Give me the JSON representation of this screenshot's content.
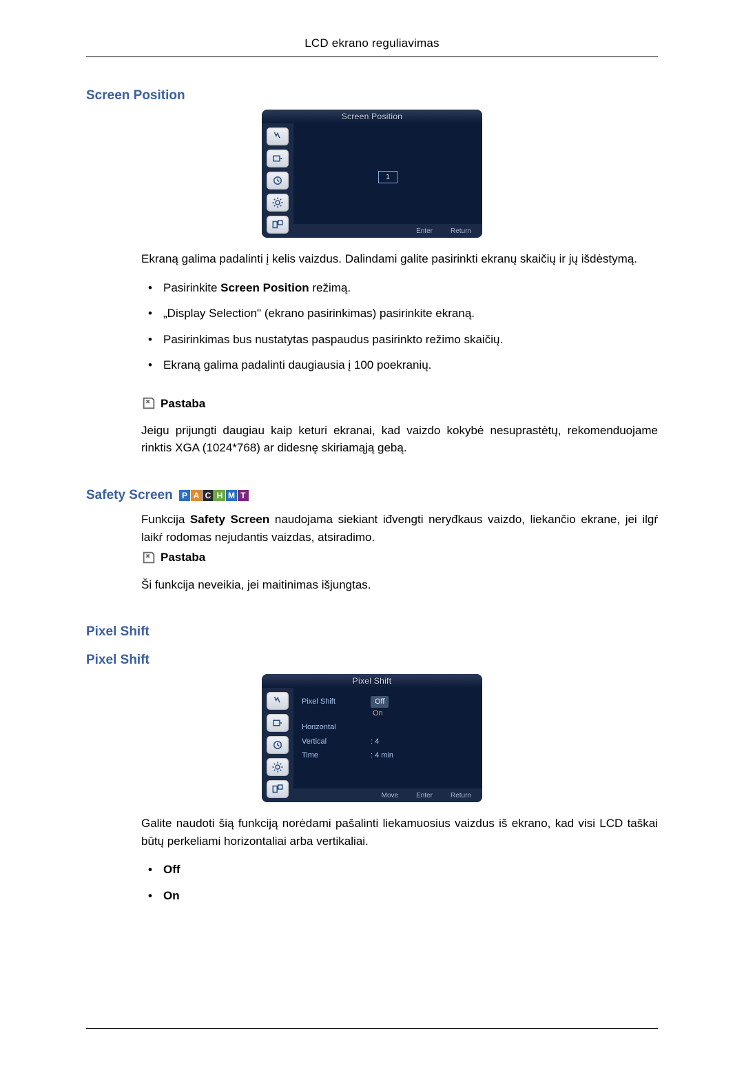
{
  "header": {
    "title": "LCD ekrano reguliavimas"
  },
  "section1": {
    "heading": "Screen Position",
    "osd": {
      "title": "Screen Position",
      "number": "1",
      "footer_enter": "Enter",
      "footer_return": "Return"
    },
    "intro": "Ekraną galima padalinti į kelis vaizdus. Dalindami galite pasirinkti ekranų skaičių ir jų išdėstymą.",
    "bullets": [
      {
        "pre": "Pasirinkite ",
        "bold": "Screen Position",
        "post": " režimą."
      },
      {
        "pre": "„Display Selection\" (ekrano pasirinkimas) pasirinkite ekraną.",
        "bold": "",
        "post": ""
      },
      {
        "pre": "Pasirinkimas bus nustatytas paspaudus pasirinkto režimo skaičių.",
        "bold": "",
        "post": ""
      },
      {
        "pre": "Ekraną galima padalinti daugiausia į 100 poekranių.",
        "bold": "",
        "post": ""
      }
    ],
    "note_label": "Pastaba",
    "note_body": "Jeigu prijungti daugiau kaip keturi ekranai, kad vaizdo kokybė nesuprastėtų, rekomenduojame rinktis XGA (1024*768) ar didesnę skiriamąją gebą."
  },
  "section2": {
    "heading": "Safety Screen",
    "badges": [
      "P",
      "A",
      "C",
      "H",
      "M",
      "T"
    ],
    "intro_pre": "Funkcija ",
    "intro_bold": "Safety Screen",
    "intro_post": " naudojama siekiant iđvengti neryđkaus vaizdo, liekančio ekrane, jei ilgŕ laikŕ rodomas nejudantis vaizdas, atsiradimo.",
    "note_label": "Pastaba",
    "note_body": "Ši funkcija neveikia, jei maitinimas išjungtas."
  },
  "section3": {
    "heading1": "Pixel Shift",
    "heading2": "Pixel Shift",
    "osd": {
      "title": "Pixel Shift",
      "rows": [
        {
          "label": "Pixel Shift",
          "value_off": "Off",
          "value_on": "On"
        },
        {
          "label": "Horizontal",
          "value": ""
        },
        {
          "label": "Vertical",
          "value": ": 4"
        },
        {
          "label": "Time",
          "value": ": 4 min"
        }
      ],
      "footer_move": "Move",
      "footer_enter": "Enter",
      "footer_return": "Return"
    },
    "intro": "Galite naudoti šią funkciją norėdami pašalinti liekamuosius vaizdus iš ekrano, kad visi LCD taškai būtų perkeliami horizontaliai arba vertikaliai.",
    "bullets": [
      "Off",
      "On"
    ]
  }
}
